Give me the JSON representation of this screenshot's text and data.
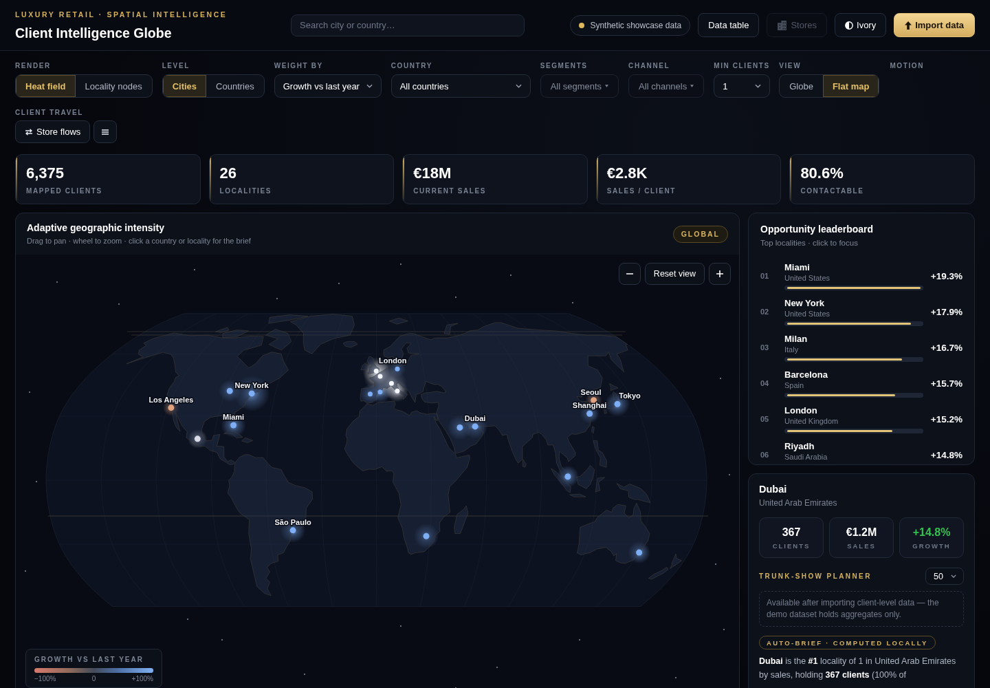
{
  "header": {
    "eyebrow": "LUXURY RETAIL · SPATIAL INTELLIGENCE",
    "title": "Client Intelligence Globe",
    "search": {
      "placeholder": "Search city or country…"
    },
    "data_source": "Synthetic showcase data",
    "buttons": [
      {
        "label": "Data table",
        "kind": "plain",
        "disabled": false
      },
      {
        "label": "Stores",
        "kind": "stores",
        "disabled": true
      },
      {
        "label": "Ivory",
        "kind": "theme",
        "disabled": false
      },
      {
        "label": "Import data",
        "kind": "primary",
        "disabled": false
      }
    ]
  },
  "controls": [
    {
      "label": "RENDER",
      "kind": "segmented",
      "options": [
        {
          "label": "Heat field",
          "selected": true
        },
        {
          "label": "Locality nodes",
          "selected": false
        }
      ]
    },
    {
      "label": "LEVEL",
      "kind": "segmented",
      "options": [
        {
          "label": "Cities",
          "selected": true
        },
        {
          "label": "Countries",
          "selected": false
        }
      ]
    },
    {
      "label": "WEIGHT BY",
      "kind": "select",
      "value": "Growth vs last year"
    },
    {
      "label": "COUNTRY",
      "kind": "select",
      "value": "All countries"
    },
    {
      "label": "SEGMENTS",
      "kind": "multiselect",
      "value": "All segments"
    },
    {
      "label": "CHANNEL",
      "kind": "multiselect",
      "value": "All channels"
    },
    {
      "label": "MIN CLIENTS",
      "kind": "select",
      "value": "1"
    },
    {
      "label": "VIEW",
      "kind": "segmented",
      "options": [
        {
          "label": "Globe",
          "selected": false
        },
        {
          "label": "Flat map",
          "selected": true
        }
      ]
    },
    {
      "label": "MOTION",
      "kind": "empty"
    }
  ],
  "travel": {
    "label": "CLIENT TRAVEL",
    "buttons": [
      {
        "kind": "flows",
        "label": "Store flows"
      },
      {
        "kind": "menu"
      }
    ]
  },
  "kpis": [
    {
      "value": "6,375",
      "label": "MAPPED CLIENTS"
    },
    {
      "value": "26",
      "label": "LOCALITIES"
    },
    {
      "value": "€18M",
      "label": "CURRENT SALES"
    },
    {
      "value": "€2.8K",
      "label": "SALES / CLIENT"
    },
    {
      "value": "80.6%",
      "label": "CONTACTABLE"
    }
  ],
  "map_panel": {
    "title": "Adaptive geographic intensity",
    "subtitle": "Drag to pan · wheel to zoom · click a country or locality for the brief",
    "scope": "GLOBAL",
    "zoom_controls": [
      {
        "kind": "zoom_out"
      },
      {
        "kind": "reset",
        "label": "Reset view"
      },
      {
        "kind": "zoom_in"
      }
    ],
    "city_labels": [
      "London",
      "New York",
      "Los Angeles",
      "Miami",
      "Seoul",
      "Tokyo",
      "Shanghai",
      "Dubai",
      "São Paulo"
    ],
    "legend": {
      "title": "GROWTH VS LAST YEAR",
      "ticks": [
        "−100%",
        "0",
        "+100%"
      ]
    }
  },
  "leaderboard": {
    "title": "Opportunity leaderboard",
    "subtitle": "Top localities · click to focus",
    "rows": [
      {
        "rank": "01",
        "name": "Miami",
        "country": "United States",
        "growth": "+19.3%",
        "level": 1
      },
      {
        "rank": "02",
        "name": "New York",
        "country": "United States",
        "growth": "+17.9%",
        "level": 0.93
      },
      {
        "rank": "03",
        "name": "Milan",
        "country": "Italy",
        "growth": "+16.7%",
        "level": 0.86
      },
      {
        "rank": "04",
        "name": "Barcelona",
        "country": "Spain",
        "growth": "+15.7%",
        "level": 0.81
      },
      {
        "rank": "05",
        "name": "London",
        "country": "United Kingdom",
        "growth": "+15.2%",
        "level": 0.79
      },
      {
        "rank": "06",
        "name": "Riyadh",
        "country": "Saudi Arabia",
        "growth": "+14.8%"
      }
    ]
  },
  "detail": {
    "title": "Dubai",
    "subtitle": "United Arab Emirates",
    "stats": [
      {
        "value": "367",
        "label": "CLIENTS",
        "positive": false
      },
      {
        "value": "€1.2M",
        "label": "SALES",
        "positive": false
      },
      {
        "value": "+14.8%",
        "label": "GROWTH",
        "positive": true
      }
    ],
    "planner": {
      "label": "TRUNK-SHOW PLANNER",
      "value": "50",
      "note": "Available after importing client-level data — the demo dataset holds aggregates only."
    },
    "brief_badge": "AUTO-BRIEF · COMPUTED LOCALLY",
    "brief": "**Dubai** is the **#1** locality of 1 in United Arab Emirates by sales, holding **367 clients** (100% of"
  }
}
